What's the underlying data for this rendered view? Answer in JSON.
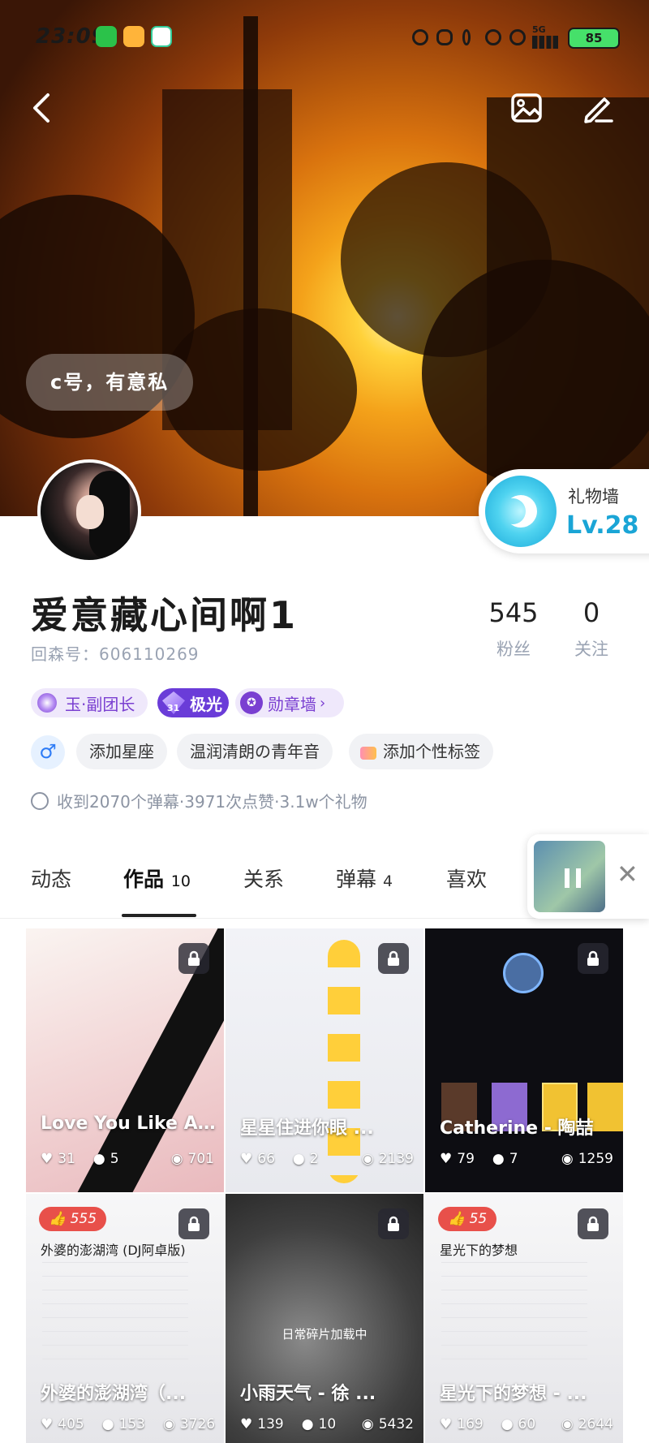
{
  "status_bar": {
    "time": "23:09",
    "network": "5G",
    "battery": "85"
  },
  "hero": {
    "motto": "c号，有意私"
  },
  "gift_wall": {
    "title": "礼物墙",
    "level": "Lv.28"
  },
  "profile": {
    "nickname": "爱意藏心间啊1",
    "uid": "回森号：606110269"
  },
  "stats": [
    {
      "value": "545",
      "label": "粉丝"
    },
    {
      "value": "0",
      "label": "关注"
    }
  ],
  "badges": {
    "group": "玉·副团长",
    "aurora_level": "31",
    "aurora": "极光",
    "medal": "勋章墙"
  },
  "tags": {
    "gender": "♂",
    "zodiac": "添加星座",
    "voice": "温润清朗の青年音",
    "personal": "添加个性标签"
  },
  "received": "收到2070个弹幕·3971次点赞·3.1w个礼物",
  "tabs": [
    {
      "label": "动态",
      "count": ""
    },
    {
      "label": "作品",
      "count": "10"
    },
    {
      "label": "关系",
      "count": ""
    },
    {
      "label": "弹幕",
      "count": "4"
    },
    {
      "label": "喜欢",
      "count": ""
    }
  ],
  "works": [
    {
      "title": "Love You Like A Lo ...",
      "likes": "31",
      "comments": "5",
      "views": "701"
    },
    {
      "title": "星星住进你眼 ...",
      "likes": "66",
      "comments": "2",
      "views": "2139"
    },
    {
      "title": "Catherine - 陶喆",
      "likes": "79",
      "comments": "7",
      "views": "1259"
    },
    {
      "title": "外婆的澎湖湾（...",
      "likes": "405",
      "comments": "153",
      "views": "3726",
      "hot": "555",
      "song": "外婆的澎湖湾 (DJ阿卓版)"
    },
    {
      "title": "小雨天气 - 徐 ...",
      "likes": "139",
      "comments": "10",
      "views": "5432",
      "loading": "日常碎片加载中"
    },
    {
      "title": "星光下的梦想 - ...",
      "likes": "169",
      "comments": "60",
      "views": "2644",
      "hot": "55",
      "song": "星光下的梦想"
    }
  ]
}
